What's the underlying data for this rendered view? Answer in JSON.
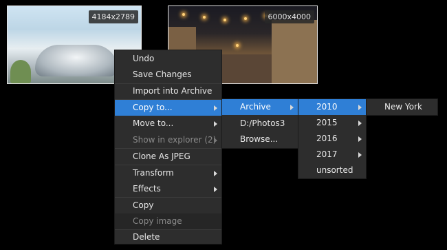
{
  "thumbnails": [
    {
      "size_label": "4184x2789"
    },
    {
      "size_label": "6000x4000"
    }
  ],
  "context_menu": {
    "items": [
      {
        "label": "Undo"
      },
      {
        "label": "Save Changes"
      },
      {
        "label": "Import into Archive"
      },
      {
        "label": "Copy to..."
      },
      {
        "label": "Move to..."
      },
      {
        "label": "Show in explorer (2)"
      },
      {
        "label": "Clone As JPEG"
      },
      {
        "label": "Transform"
      },
      {
        "label": "Effects"
      },
      {
        "label": "Copy"
      },
      {
        "label": "Copy image"
      },
      {
        "label": "Delete"
      }
    ]
  },
  "copy_to_submenu": {
    "items": [
      {
        "label": "Archive"
      },
      {
        "label": "D:/Photos3"
      },
      {
        "label": "Browse..."
      }
    ]
  },
  "archive_submenu": {
    "items": [
      {
        "label": "2010"
      },
      {
        "label": "2015"
      },
      {
        "label": "2016"
      },
      {
        "label": "2017"
      },
      {
        "label": "unsorted"
      }
    ]
  },
  "year_submenu": {
    "items": [
      {
        "label": "New York"
      }
    ]
  },
  "colors": {
    "highlight": "#2f7fd6",
    "menu_bg": "#2d2d2d",
    "background": "#000000"
  }
}
